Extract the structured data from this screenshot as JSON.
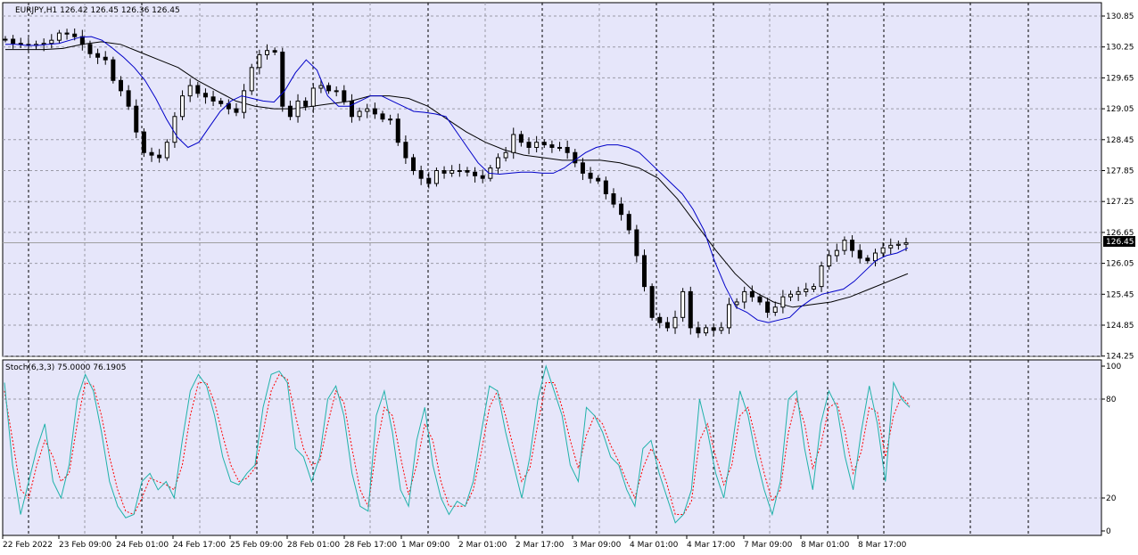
{
  "main_label": "EURJPY,H1  126.42 126.45 126.36 126.45",
  "sub_label": "Stoch(6,3,3) 75.0000 76.1905",
  "current_price": "126.45",
  "colors": {
    "background": "#ffffff",
    "plot_bg": "#e6e6fa",
    "grid": "#9a9aa6",
    "candle": "#000000",
    "ma_fast": "#0000c8",
    "ma_slow": "#000000",
    "stoch_main": "#20b2aa",
    "stoch_signal": "#ff0000",
    "price_line": "#a0a0a0"
  },
  "chart_data": [
    {
      "type": "candlestick",
      "symbol": "EURJPY",
      "timeframe": "H1",
      "ohlc_label": {
        "open": 126.42,
        "high": 126.45,
        "low": 126.36,
        "close": 126.45
      },
      "current_price": 126.45,
      "y_ticks": [
        "130.85",
        "130.25",
        "129.65",
        "129.05",
        "128.45",
        "127.85",
        "127.25",
        "126.65",
        "126.05",
        "125.45",
        "124.85",
        "124.25"
      ],
      "ylim": [
        124.2,
        130.95
      ],
      "x_ticks": [
        "22 Feb 2022",
        "23 Feb 09:00",
        "24 Feb 01:00",
        "24 Feb 17:00",
        "25 Feb 09:00",
        "28 Feb 01:00",
        "28 Feb 17:00",
        "1 Mar 09:00",
        "2 Mar 01:00",
        "2 Mar 17:00",
        "3 Mar 09:00",
        "4 Mar 01:00",
        "4 Mar 17:00",
        "7 Mar 09:00",
        "8 Mar 01:00",
        "8 Mar 17:00"
      ],
      "series": [
        {
          "name": "close",
          "values": [
            130.4,
            130.32,
            130.3,
            130.28,
            130.3,
            130.32,
            130.38,
            130.52,
            130.5,
            130.45,
            130.3,
            130.12,
            130.05,
            130.0,
            129.6,
            129.4,
            129.1,
            128.6,
            128.2,
            128.15,
            128.1,
            128.4,
            128.9,
            129.3,
            129.5,
            129.35,
            129.28,
            129.2,
            129.15,
            129.05,
            128.98,
            129.4,
            129.85,
            130.1,
            130.18,
            130.15,
            129.1,
            128.9,
            129.2,
            129.1,
            129.45,
            129.5,
            129.4,
            129.4,
            129.2,
            128.9,
            129.0,
            129.05,
            128.95,
            128.85,
            128.85,
            128.4,
            128.1,
            127.85,
            127.7,
            127.6,
            127.85,
            127.8,
            127.85,
            127.85,
            127.82,
            127.75,
            127.7,
            127.9,
            128.1,
            128.2,
            128.55,
            128.4,
            128.3,
            128.4,
            128.35,
            128.3,
            128.3,
            128.2,
            128.0,
            127.8,
            127.7,
            127.65,
            127.4,
            127.2,
            127.0,
            126.7,
            126.2,
            125.6,
            125.0,
            124.9,
            124.8,
            125.0,
            125.5,
            124.8,
            124.7,
            124.8,
            124.75,
            124.8,
            125.25,
            125.3,
            125.5,
            125.4,
            125.3,
            125.1,
            125.2,
            125.4,
            125.45,
            125.5,
            125.55,
            125.6,
            126.0,
            126.2,
            126.3,
            126.5,
            126.3,
            126.15,
            126.1,
            126.25,
            126.35,
            126.4,
            126.42,
            126.45
          ]
        },
        {
          "name": "MA fast",
          "values": [
            130.3,
            130.3,
            130.28,
            130.28,
            130.3,
            130.32,
            130.38,
            130.44,
            130.45,
            130.38,
            130.22,
            130.05,
            129.85,
            129.6,
            129.25,
            128.85,
            128.5,
            128.3,
            128.4,
            128.7,
            129.0,
            129.2,
            129.3,
            129.25,
            129.2,
            129.18,
            129.4,
            129.75,
            130.0,
            129.8,
            129.3,
            129.1,
            129.1,
            129.2,
            129.3,
            129.3,
            129.2,
            129.1,
            129.0,
            128.98,
            128.95,
            128.9,
            128.6,
            128.3,
            128.0,
            127.8,
            127.78,
            127.8,
            127.82,
            127.82,
            127.8,
            127.8,
            127.9,
            128.05,
            128.2,
            128.3,
            128.35,
            128.35,
            128.3,
            128.2,
            128.0,
            127.8,
            127.6,
            127.4,
            127.1,
            126.7,
            126.1,
            125.6,
            125.2,
            125.1,
            124.95,
            124.9,
            124.95,
            125.0,
            125.2,
            125.35,
            125.45,
            125.5,
            125.55,
            125.7,
            125.9,
            126.1,
            126.2,
            126.25,
            126.35
          ]
        },
        {
          "name": "MA slow",
          "values": [
            130.2,
            130.2,
            130.2,
            130.22,
            130.3,
            130.35,
            130.3,
            130.15,
            130.0,
            129.85,
            129.6,
            129.4,
            129.2,
            129.1,
            129.05,
            129.05,
            129.1,
            129.15,
            129.2,
            129.3,
            129.3,
            129.25,
            129.1,
            128.85,
            128.6,
            128.4,
            128.25,
            128.15,
            128.1,
            128.05,
            128.05,
            128.05,
            128.0,
            127.9,
            127.7,
            127.3,
            126.8,
            126.3,
            125.85,
            125.5,
            125.3,
            125.2,
            125.25,
            125.3,
            125.4,
            125.55,
            125.7,
            125.85
          ]
        }
      ]
    },
    {
      "type": "line",
      "name": "Stoch(6,3,3)",
      "main_value": 75.0,
      "signal_value": 76.1905,
      "y_ticks": [
        "100",
        "80",
        "20",
        "0"
      ],
      "ylim": [
        0,
        100
      ],
      "series": [
        {
          "name": "%K",
          "values": [
            90,
            40,
            10,
            30,
            50,
            65,
            30,
            20,
            40,
            80,
            95,
            85,
            60,
            30,
            15,
            8,
            10,
            30,
            35,
            25,
            30,
            20,
            55,
            85,
            95,
            88,
            70,
            45,
            30,
            28,
            35,
            40,
            75,
            95,
            97,
            90,
            50,
            45,
            30,
            45,
            80,
            88,
            70,
            35,
            15,
            12,
            70,
            85,
            60,
            25,
            15,
            55,
            75,
            40,
            20,
            10,
            18,
            15,
            30,
            60,
            88,
            85,
            60,
            40,
            20,
            45,
            80,
            100,
            85,
            70,
            40,
            30,
            75,
            70,
            60,
            45,
            40,
            25,
            15,
            50,
            55,
            35,
            20,
            5,
            10,
            25,
            80,
            60,
            35,
            20,
            50,
            85,
            70,
            45,
            25,
            10,
            30,
            80,
            85,
            50,
            25,
            65,
            85,
            75,
            45,
            25,
            60,
            88,
            65,
            30,
            90,
            80,
            75
          ]
        },
        {
          "name": "%D",
          "values": [
            85,
            55,
            25,
            20,
            40,
            55,
            45,
            30,
            35,
            65,
            90,
            88,
            70,
            45,
            25,
            12,
            10,
            20,
            32,
            30,
            28,
            25,
            40,
            70,
            90,
            90,
            78,
            58,
            40,
            30,
            32,
            38,
            60,
            85,
            95,
            92,
            70,
            50,
            40,
            42,
            65,
            85,
            78,
            50,
            25,
            15,
            50,
            75,
            70,
            45,
            22,
            40,
            65,
            55,
            30,
            15,
            15,
            15,
            25,
            48,
            75,
            85,
            70,
            50,
            30,
            38,
            65,
            90,
            90,
            75,
            55,
            38,
            58,
            70,
            65,
            52,
            42,
            30,
            20,
            38,
            50,
            42,
            28,
            10,
            10,
            18,
            55,
            65,
            45,
            28,
            40,
            70,
            75,
            55,
            35,
            18,
            25,
            60,
            80,
            65,
            38,
            52,
            75,
            78,
            60,
            35,
            48,
            75,
            72,
            45,
            70,
            82,
            76
          ]
        }
      ]
    }
  ]
}
